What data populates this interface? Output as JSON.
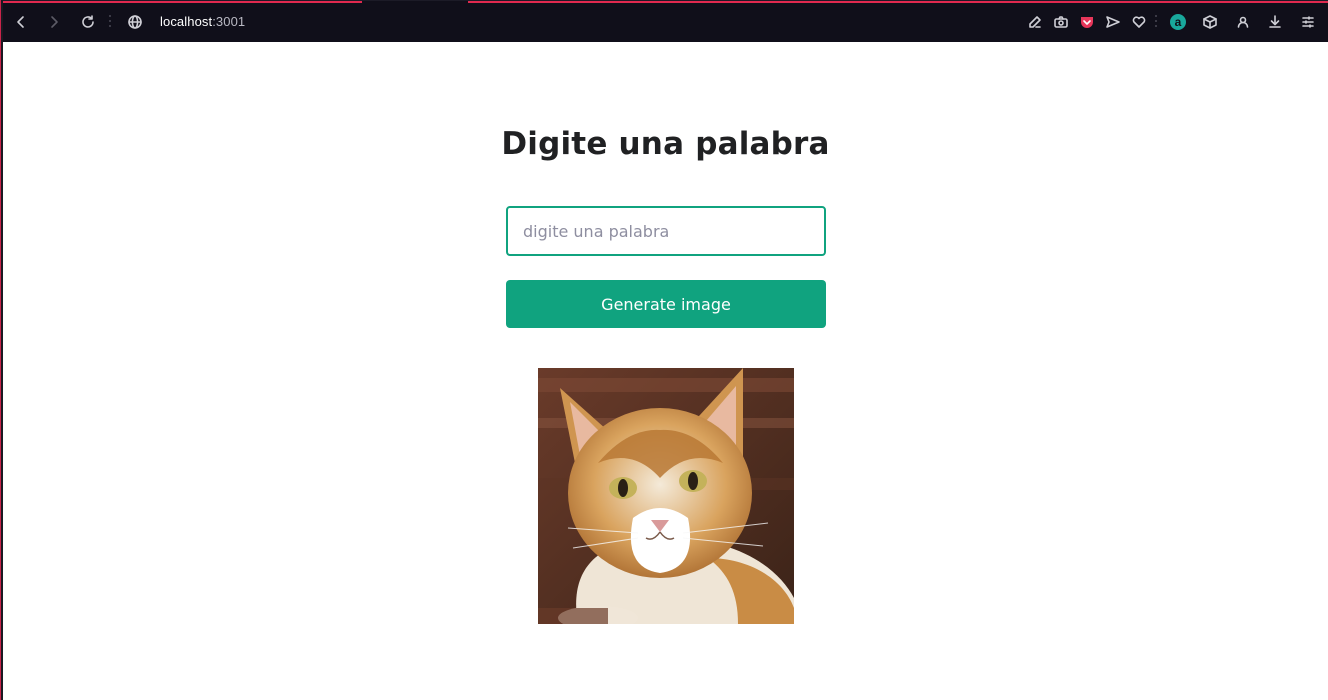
{
  "browser": {
    "url_host": "localhost",
    "url_port": ":3001",
    "toolbar_icons": [
      "back-icon",
      "forward-icon",
      "reload-icon",
      "globe-icon",
      "edit-icon",
      "camera-icon",
      "pocket-icon",
      "send-icon",
      "heart-icon",
      "account-icon",
      "cube-icon",
      "profile-icon",
      "download-icon",
      "menu-icon"
    ],
    "extension_badge": "a",
    "accent_color": "#e0294f"
  },
  "main": {
    "title": "Digite una palabra",
    "input": {
      "placeholder": "digite una palabra",
      "value": ""
    },
    "button_label": "Generate image",
    "image": {
      "subject": "cat-photo"
    },
    "colors": {
      "primary": "#10a37f",
      "text": "#202123"
    }
  }
}
